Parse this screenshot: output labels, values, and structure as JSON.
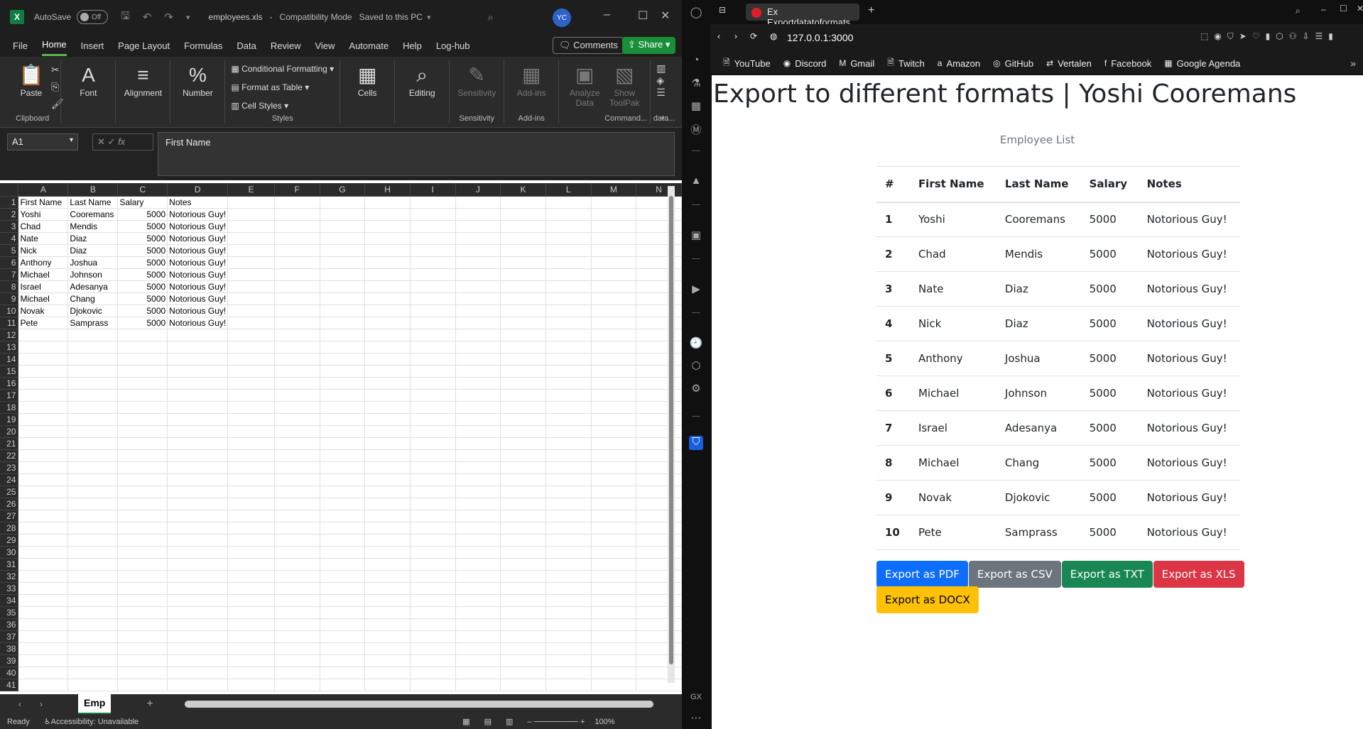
{
  "excel": {
    "titlebar": {
      "autosave_label": "AutoSave",
      "autosave_state": "Off",
      "filename": "employees.xls",
      "separator": "-",
      "mode": "Compatibility Mode",
      "saved_status": "Saved to this PC",
      "user_initials": "YC"
    },
    "menu": [
      "File",
      "Home",
      "Insert",
      "Page Layout",
      "Formulas",
      "Data",
      "Review",
      "View",
      "Automate",
      "Help",
      "Log-hub"
    ],
    "comments_label": "Comments",
    "share_label": "Share",
    "ribbon": {
      "clipboard": {
        "paste": "Paste",
        "group": "Clipboard"
      },
      "font": "Font",
      "alignment": "Alignment",
      "number": "Number",
      "styles": {
        "conditional": "Conditional Formatting",
        "table": "Format as Table",
        "cell_styles": "Cell Styles",
        "group": "Styles"
      },
      "cells": "Cells",
      "editing": "Editing",
      "sensitivity": {
        "label": "Sensitivity",
        "group": "Sensitivity"
      },
      "addins": {
        "label": "Add-ins",
        "group": "Add-ins"
      },
      "analyze": {
        "label1": "Analyze",
        "label2": "Data"
      },
      "toolpak": {
        "label1": "Show",
        "label2": "ToolPak",
        "group": "Command..."
      },
      "data_group": "data..."
    },
    "formula": {
      "namebox": "A1",
      "fx": "fx",
      "content": "First Name"
    },
    "columns": [
      "A",
      "B",
      "C",
      "D",
      "E",
      "F",
      "G",
      "H",
      "I",
      "J",
      "K",
      "L",
      "M",
      "N"
    ],
    "header_row": [
      "First Name",
      "Last Name",
      "Salary",
      "Notes"
    ],
    "rows": [
      [
        "Yoshi",
        "Cooremans",
        "5000",
        "Notorious Guy!"
      ],
      [
        "Chad",
        "Mendis",
        "5000",
        "Notorious Guy!"
      ],
      [
        "Nate",
        "Diaz",
        "5000",
        "Notorious Guy!"
      ],
      [
        "Nick",
        "Diaz",
        "5000",
        "Notorious Guy!"
      ],
      [
        "Anthony",
        "Joshua",
        "5000",
        "Notorious Guy!"
      ],
      [
        "Michael",
        "Johnson",
        "5000",
        "Notorious Guy!"
      ],
      [
        "Israel",
        "Adesanya",
        "5000",
        "Notorious Guy!"
      ],
      [
        "Michael",
        "Chang",
        "5000",
        "Notorious Guy!"
      ],
      [
        "Novak",
        "Djokovic",
        "5000",
        "Notorious Guy!"
      ],
      [
        "Pete",
        "Samprass",
        "5000",
        "Notorious Guy!"
      ]
    ],
    "row_count": 41,
    "sheet_tab": "Emp",
    "status": {
      "ready": "Ready",
      "accessibility": "Accessibility: Unavailable",
      "zoom": "100%"
    }
  },
  "browser": {
    "tab_title": "Ex Exportdatatoformats",
    "url": "127.0.0.1:3000",
    "bookmarks": [
      {
        "label": "YouTube",
        "icon": "page-icon"
      },
      {
        "label": "Discord",
        "icon": "discord-icon"
      },
      {
        "label": "Gmail",
        "icon": "gmail-icon"
      },
      {
        "label": "Twitch",
        "icon": "page-icon"
      },
      {
        "label": "Amazon",
        "icon": "amazon-icon"
      },
      {
        "label": "GitHub",
        "icon": "github-icon"
      },
      {
        "label": "Vertalen",
        "icon": "translate-icon"
      },
      {
        "label": "Facebook",
        "icon": "facebook-icon"
      },
      {
        "label": "Google Agenda",
        "icon": "calendar-icon"
      }
    ],
    "sidebar_bottom": "GX",
    "page": {
      "heading": "Export to different formats | Yoshi Cooremans",
      "caption": "Employee List",
      "headers": [
        "#",
        "First Name",
        "Last Name",
        "Salary",
        "Notes"
      ],
      "rows": [
        [
          "1",
          "Yoshi",
          "Cooremans",
          "5000",
          "Notorious Guy!"
        ],
        [
          "2",
          "Chad",
          "Mendis",
          "5000",
          "Notorious Guy!"
        ],
        [
          "3",
          "Nate",
          "Diaz",
          "5000",
          "Notorious Guy!"
        ],
        [
          "4",
          "Nick",
          "Diaz",
          "5000",
          "Notorious Guy!"
        ],
        [
          "5",
          "Anthony",
          "Joshua",
          "5000",
          "Notorious Guy!"
        ],
        [
          "6",
          "Michael",
          "Johnson",
          "5000",
          "Notorious Guy!"
        ],
        [
          "7",
          "Israel",
          "Adesanya",
          "5000",
          "Notorious Guy!"
        ],
        [
          "8",
          "Michael",
          "Chang",
          "5000",
          "Notorious Guy!"
        ],
        [
          "9",
          "Novak",
          "Djokovic",
          "5000",
          "Notorious Guy!"
        ],
        [
          "10",
          "Pete",
          "Samprass",
          "5000",
          "Notorious Guy!"
        ]
      ],
      "buttons": [
        {
          "label": "Export as PDF",
          "style": "primary",
          "color": "#0d6efd"
        },
        {
          "label": "Export as CSV",
          "style": "secondary",
          "color": "#6c757d"
        },
        {
          "label": "Export as TXT",
          "style": "success",
          "color": "#198754"
        },
        {
          "label": "Export as XLS",
          "style": "danger",
          "color": "#dc3545"
        },
        {
          "label": "Export as DOCX",
          "style": "warning",
          "color": "#ffc107"
        }
      ]
    }
  }
}
